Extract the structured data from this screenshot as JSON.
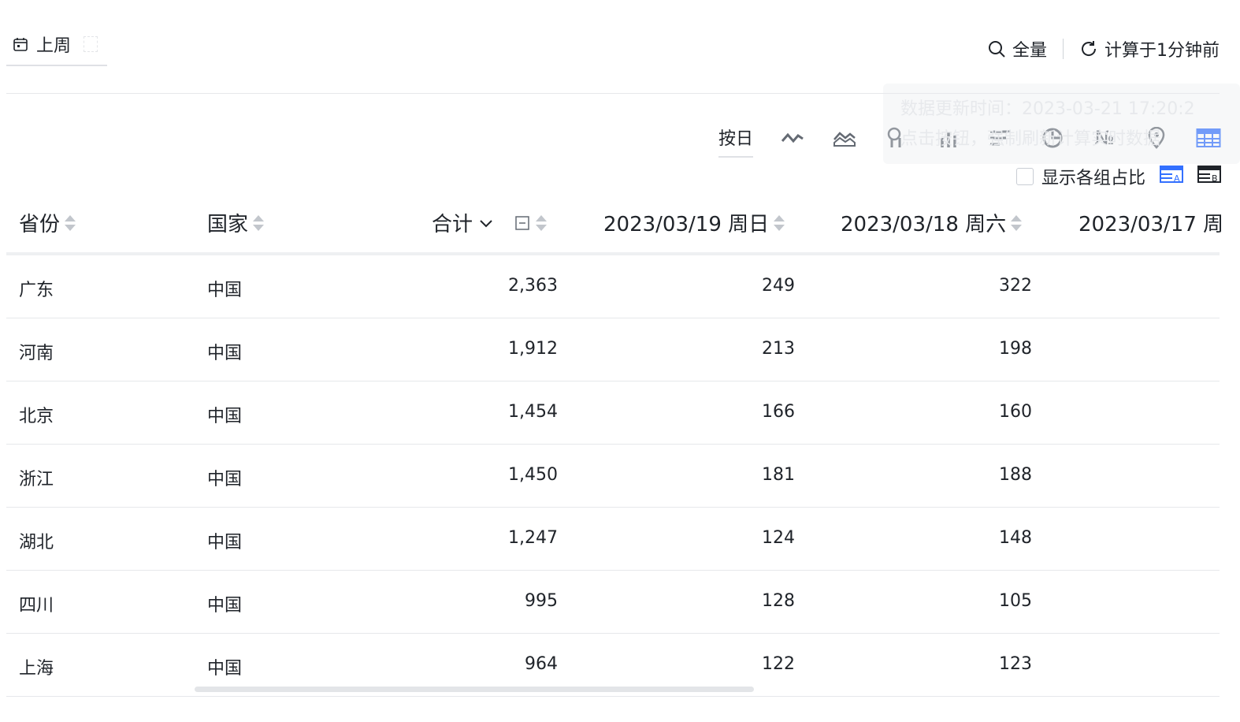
{
  "top": {
    "date_label": "上周",
    "search_label": "全量",
    "refresh_label": "计算于1分钟前"
  },
  "tooltip": {
    "line1": "数据更新时间：2023-03-21 17:20:2",
    "line2": "点击按钮，强制刷新计算实时数据"
  },
  "chart_toolbar": {
    "granularity": "按日",
    "icons": [
      "line-chart-icon",
      "area-chart-icon",
      "funnel-chart-icon",
      "bar-chart-icon",
      "horizontal-bar-icon",
      "pie-chart-icon",
      "number-icon",
      "map-icon",
      "table-icon"
    ],
    "active_icon": "table-icon",
    "show_ratio_label": "显示各组占比",
    "accent": "#3370ff"
  },
  "table": {
    "headers": {
      "province": "省份",
      "country": "国家",
      "total": "合计",
      "d1": "2023/03/19 周日",
      "d2": "2023/03/18 周六",
      "d3": "2023/03/17 周"
    },
    "rows": [
      {
        "province": "广东",
        "country": "中国",
        "total": "2,363",
        "d1": "249",
        "d2": "322"
      },
      {
        "province": "河南",
        "country": "中国",
        "total": "1,912",
        "d1": "213",
        "d2": "198"
      },
      {
        "province": "北京",
        "country": "中国",
        "total": "1,454",
        "d1": "166",
        "d2": "160"
      },
      {
        "province": "浙江",
        "country": "中国",
        "total": "1,450",
        "d1": "181",
        "d2": "188"
      },
      {
        "province": "湖北",
        "country": "中国",
        "total": "1,247",
        "d1": "124",
        "d2": "148"
      },
      {
        "province": "四川",
        "country": "中国",
        "total": "995",
        "d1": "128",
        "d2": "105"
      },
      {
        "province": "上海",
        "country": "中国",
        "total": "964",
        "d1": "122",
        "d2": "123"
      }
    ]
  }
}
